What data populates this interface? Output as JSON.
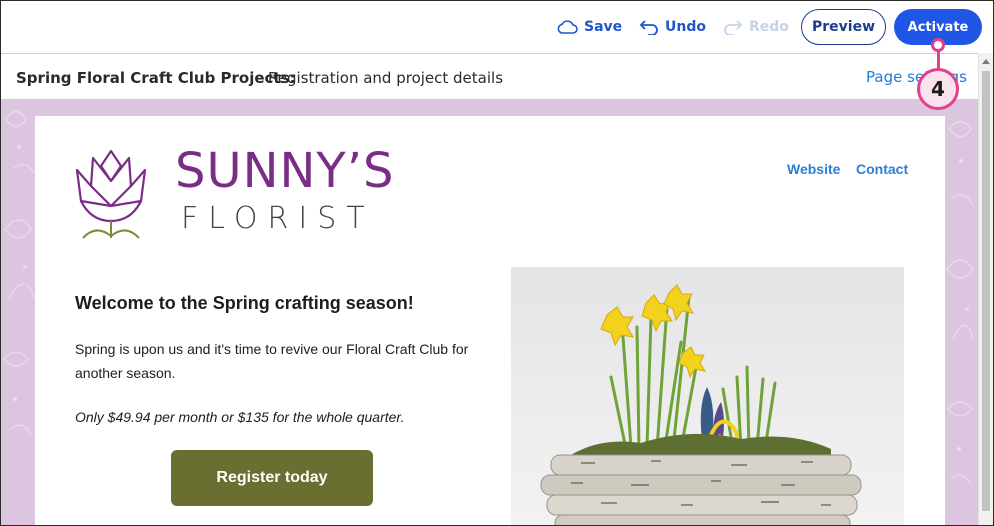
{
  "toolbar": {
    "save_label": "Save",
    "undo_label": "Undo",
    "redo_label": "Redo",
    "preview_label": "Preview",
    "activate_label": "Activate"
  },
  "titlebar": {
    "name": "Spring Floral Craft Club Projects:",
    "subtitle": "Registration and project details",
    "page_settings_label": "Page settings"
  },
  "email": {
    "logo": {
      "brand": "SUNNY’S",
      "tagline": "FLORIST"
    },
    "nav": {
      "website": "Website",
      "contact": "Contact"
    },
    "welcome": "Welcome to the Spring crafting season!",
    "body1": "Spring is upon us and it's time to revive our Floral Craft Club for another season.",
    "body2": "Only $49.94 per month or $135 for the whole quarter.",
    "register_label": "Register today"
  },
  "callout": {
    "number": "4"
  },
  "colors": {
    "accent": "#1f56e6",
    "brand_purple": "#7a2d86",
    "link_blue": "#2a7fd4",
    "button_olive": "#6b6e31",
    "callout_pink": "#e0418a",
    "background_lavender": "#dcc5df"
  }
}
